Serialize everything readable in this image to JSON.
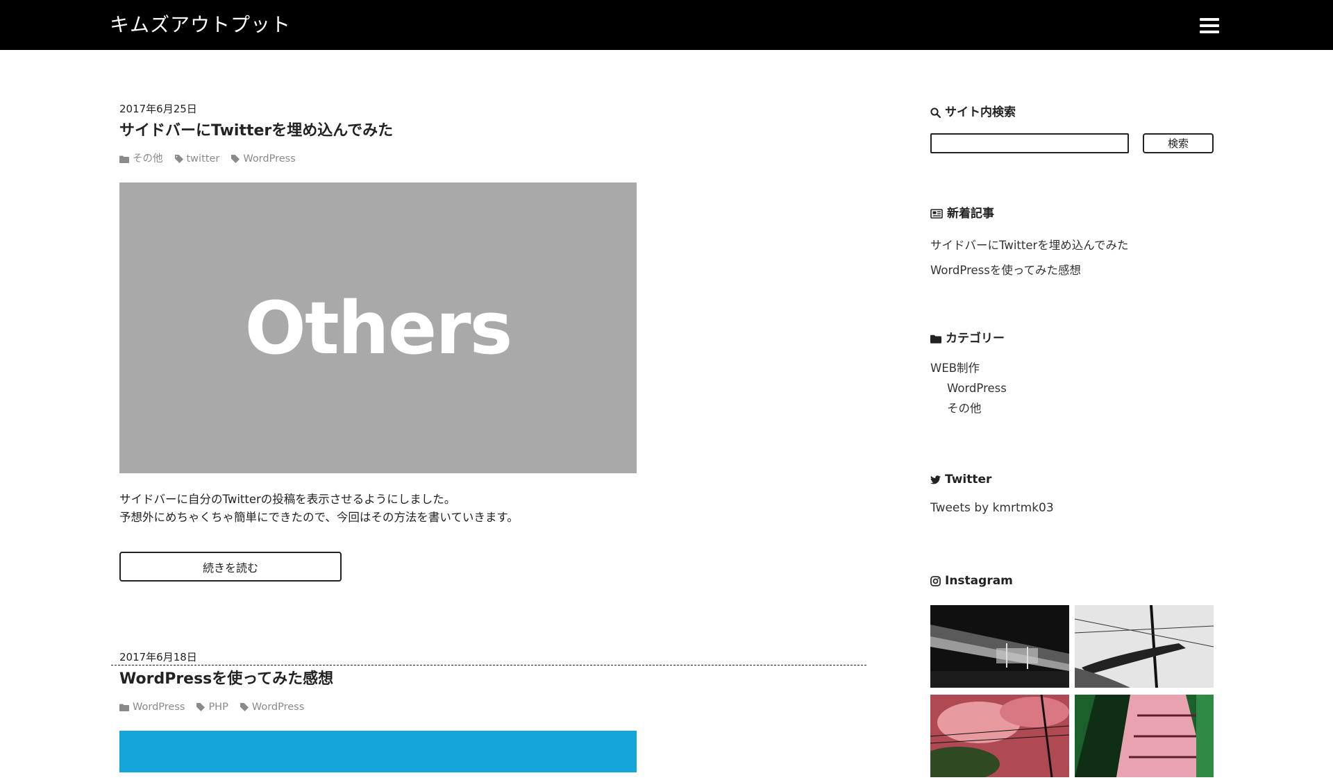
{
  "header": {
    "site_title": "キムズアウトプット",
    "menu_icon": "hamburger-menu-icon"
  },
  "posts": [
    {
      "date": "2017年6月25日",
      "title": "サイドバーにTwitterを埋め込んでみた",
      "category": "その他",
      "tags": [
        "twitter",
        "WordPress"
      ],
      "thumbnail_text": "Others",
      "thumbnail_color": "#a9a9a9",
      "excerpt_lines": [
        "サイドバーに自分のTwitterの投稿を表示させるようにしました。",
        "予想外にめちゃくちゃ簡単にできたので、今回はその方法を書いていきます。"
      ],
      "read_more": "続きを読む"
    },
    {
      "date": "2017年6月18日",
      "title": "WordPressを使ってみた感想",
      "category": "WordPress",
      "tags": [
        "PHP",
        "WordPress"
      ],
      "thumbnail_color": "#14a5db"
    }
  ],
  "sidebar": {
    "search": {
      "title": "サイト内検索",
      "button": "検索",
      "value": ""
    },
    "recent": {
      "title": "新着記事",
      "items": [
        "サイドバーにTwitterを埋め込んでみた",
        "WordPressを使ってみた感想"
      ]
    },
    "categories": {
      "title": "カテゴリー",
      "parent": "WEB制作",
      "children": [
        "WordPress",
        "その他"
      ]
    },
    "twitter": {
      "title": "Twitter",
      "text": "Tweets by kmrtmk03"
    },
    "instagram": {
      "title": "Instagram"
    }
  },
  "colors": {
    "header_bg": "#000000",
    "text": "#222222",
    "meta": "#8a8a8a"
  }
}
